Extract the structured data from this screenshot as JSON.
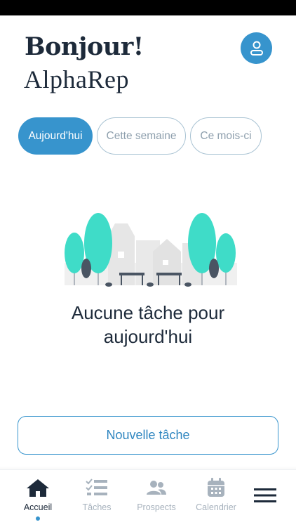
{
  "header": {
    "greeting": "Bonjour!",
    "username": "AlphaRep"
  },
  "filters": {
    "today": "Aujourd'hui",
    "week": "Cette semaine",
    "month": "Ce mois-ci",
    "selected": "Aujourd'hui"
  },
  "empty_state": {
    "line1": "Aucune tâche pour",
    "line2": "aujourd'hui"
  },
  "actions": {
    "new_task": "Nouvelle tâche"
  },
  "nav": {
    "items": [
      {
        "label": "Accueil",
        "icon": "home-icon",
        "active": true
      },
      {
        "label": "Tâches",
        "icon": "task-list-icon",
        "active": false
      },
      {
        "label": "Prospects",
        "icon": "people-icon",
        "active": false
      },
      {
        "label": "Calendrier",
        "icon": "calendar-icon",
        "active": false
      }
    ],
    "menu_icon": "hamburger-menu-icon"
  },
  "colors": {
    "primary": "#3794cd",
    "text_dark": "#1d2a3a",
    "muted": "#a7b2bd",
    "tree": "#3fdcc8"
  }
}
